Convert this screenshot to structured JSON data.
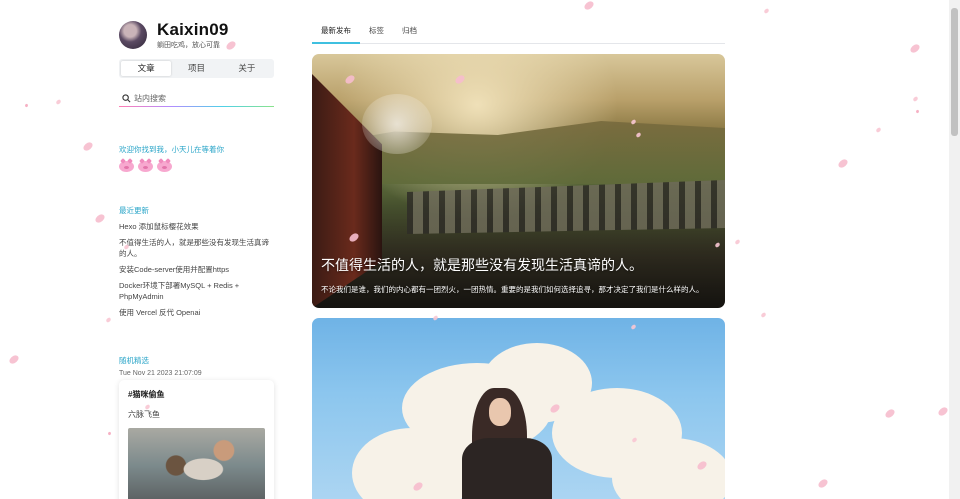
{
  "profile": {
    "name": "Kaixin09",
    "motto": "躺田吃鸡，放心可靠"
  },
  "sidebar_tabs": [
    {
      "label": "文章",
      "active": true
    },
    {
      "label": "项目",
      "active": false
    },
    {
      "label": "关于",
      "active": false
    }
  ],
  "search": {
    "placeholder": "站内搜索",
    "icon": "search-icon"
  },
  "welcome": {
    "title": "欢迎你找到我，小天儿在等着你",
    "emoji_icons": [
      "pig-emoji",
      "pig-emoji",
      "pig-emoji"
    ]
  },
  "recent": {
    "title": "最近更新",
    "items": [
      "Hexo 添加鼠标樱花效果",
      "不值得生活的人，就是那些没有发现生活真谛的人。",
      "安装Code-server使用并配置https",
      "Docker环境下部署MySQL + Redis + PhpMyAdmin",
      "使用 Vercel 反代 Openai"
    ]
  },
  "random": {
    "title": "随机精选",
    "date": "Tue Nov 21 2023 21:07:09",
    "card_tag": "#猫咪偷鱼",
    "card_sub": "六脉飞鱼"
  },
  "main_nav": [
    {
      "label": "最新发布",
      "active": true
    },
    {
      "label": "标签",
      "active": false
    },
    {
      "label": "归档",
      "active": false
    }
  ],
  "posts": [
    {
      "title": "不值得生活的人，就是那些没有发现生活真谛的人。",
      "desc": "不论我们是谁，我们的内心都有一团烈火，一团热情。重要的是我们如何选择追寻，那才决定了我们是什么样的人。"
    }
  ],
  "colors": {
    "accent": "#3fc0e0",
    "section_title": "#2aa5c8",
    "petal": "#f6bccd"
  }
}
